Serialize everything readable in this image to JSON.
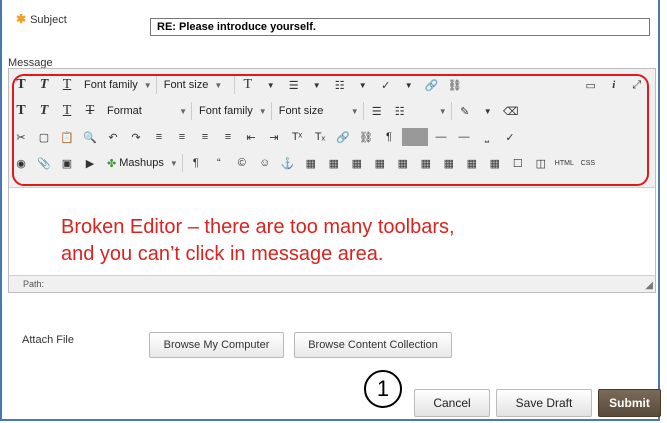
{
  "subject": {
    "label": "Subject",
    "value": "RE: Please introduce yourself."
  },
  "message": {
    "label": "Message"
  },
  "toolbar": {
    "row1": {
      "font_family": "Font family",
      "font_size": "Font size"
    },
    "row2": {
      "format": "Format",
      "font_family": "Font family",
      "font_size": "Font size"
    },
    "row4": {
      "mashups": "Mashups",
      "html": "HTML",
      "css": "CSS"
    }
  },
  "annotation": {
    "line1": "Broken Editor – there are too many toolbars,",
    "line2": "and you can’t click in message area."
  },
  "path_label": "Path:",
  "attach": {
    "label": "Attach File",
    "browse_computer": "Browse My Computer",
    "browse_collection": "Browse Content Collection"
  },
  "step_number": "1",
  "actions": {
    "cancel": "Cancel",
    "save_draft": "Save Draft",
    "submit": "Submit"
  },
  "colors": {
    "frame_border": "#4a78b0",
    "annotation_red": "#d8231e",
    "submit_bg": "#5a4a3a",
    "required_star": "#f0a020"
  }
}
